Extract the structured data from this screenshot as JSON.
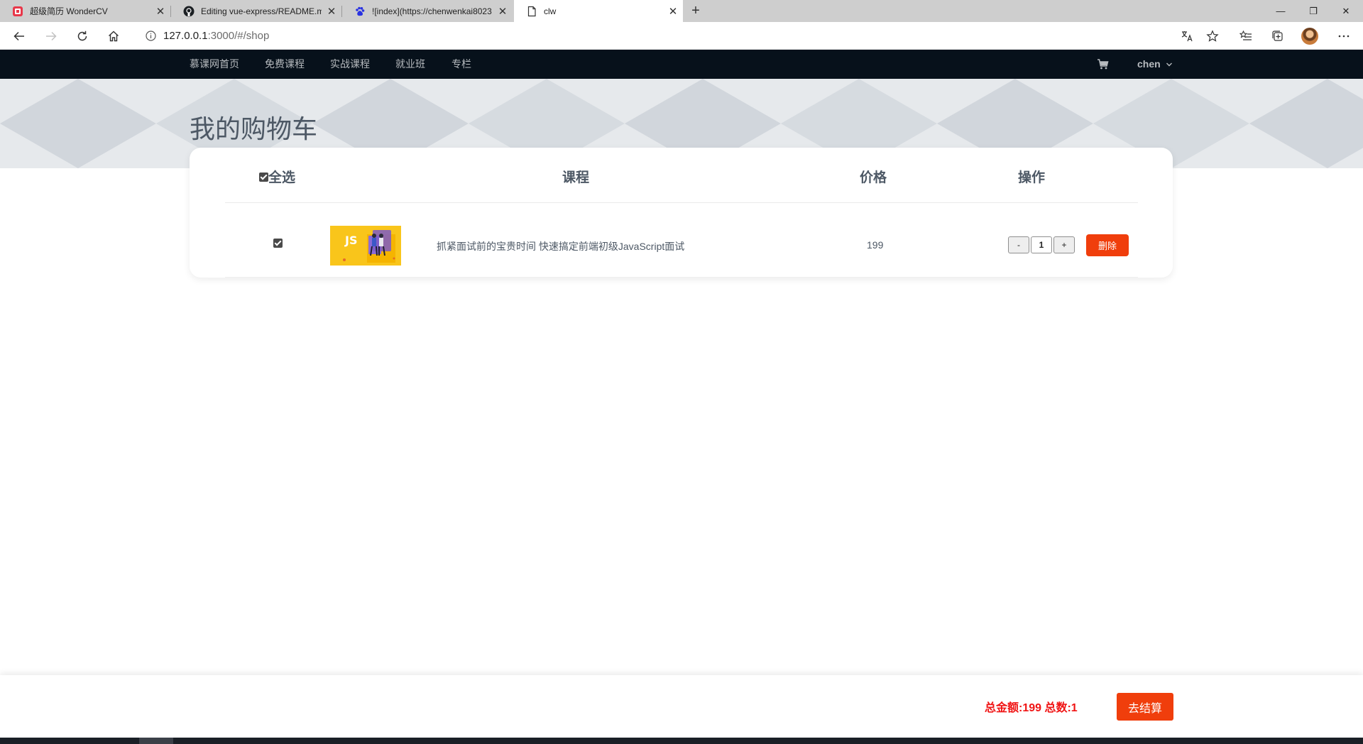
{
  "browser": {
    "tabs": [
      {
        "title": "超级简历 WonderCV",
        "favicon": "wondercv-icon",
        "active": false
      },
      {
        "title": "Editing vue-express/README.md",
        "favicon": "github-icon",
        "active": false
      },
      {
        "title": "![index](https://chenwenkai8023",
        "favicon": "baidu-icon",
        "active": false
      },
      {
        "title": "clw",
        "favicon": "page-icon",
        "active": true
      }
    ],
    "new_tab": "+",
    "url_host": "127.0.0.1",
    "url_rest": ":3000/#/shop",
    "window_controls": {
      "minimize": "—",
      "restore": "❐",
      "close": "✕"
    }
  },
  "site": {
    "nav": [
      "慕课网首页",
      "免费课程",
      "实战课程",
      "就业班",
      "专栏"
    ],
    "user": "chen"
  },
  "page_title": "我的购物车",
  "cart": {
    "headers": {
      "select_all": "全选",
      "course": "课程",
      "price": "价格",
      "action": "操作"
    },
    "items": [
      {
        "name": "抓紧面试前的宝贵时间 快速搞定前端初级JavaScript面试",
        "price": "199",
        "quantity": "1",
        "thumb_text": "JS"
      }
    ],
    "minus": "-",
    "plus": "+",
    "delete_label": "删除"
  },
  "summary": {
    "text": "总金额:199 总数:1",
    "checkout_label": "去结算"
  },
  "colors": {
    "accent": "#f03e0c",
    "nav_bg": "#07111b",
    "total_text": "#f01414"
  }
}
